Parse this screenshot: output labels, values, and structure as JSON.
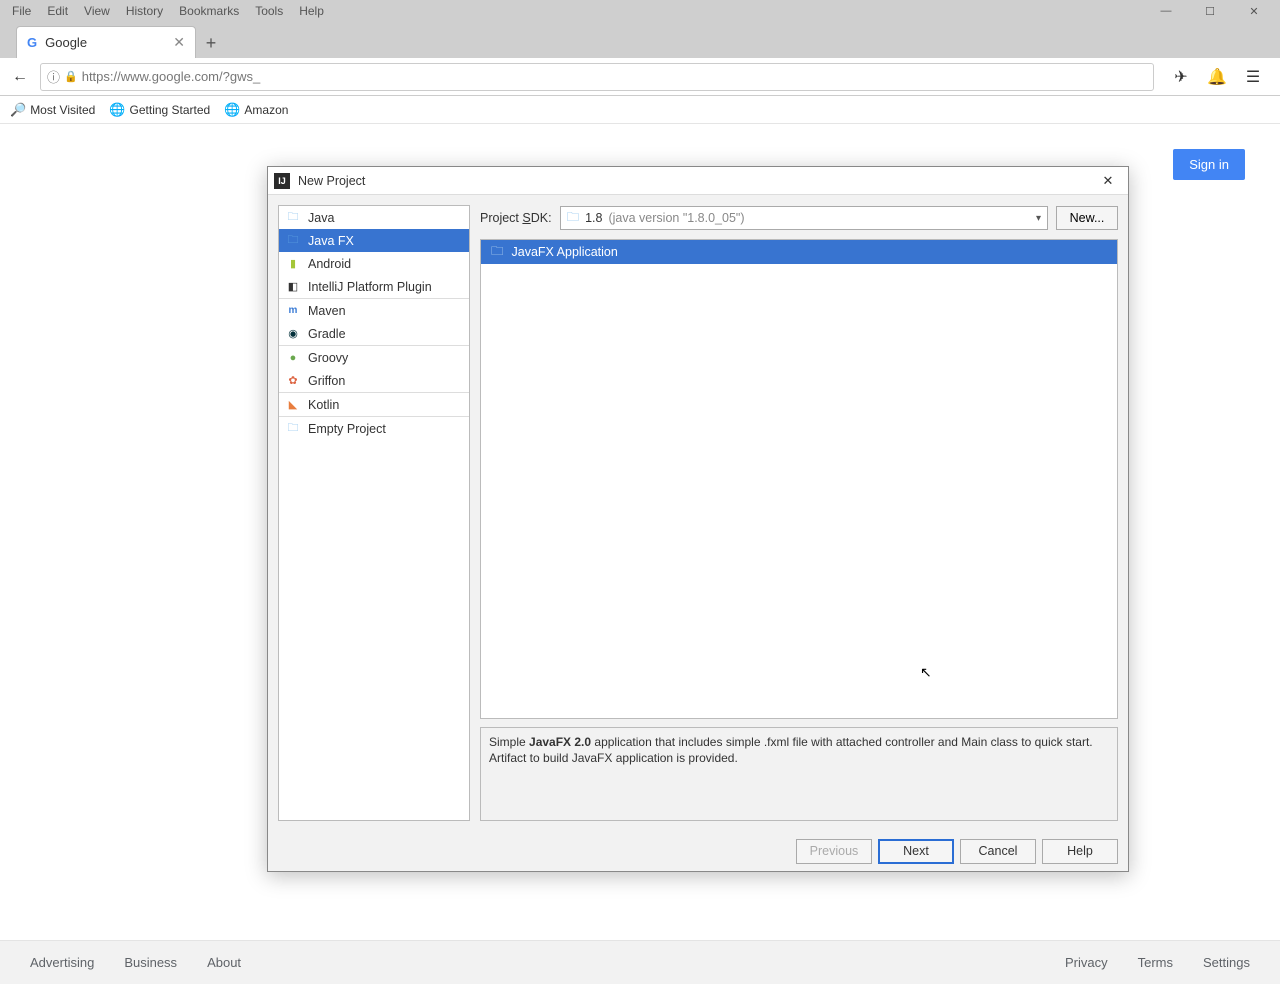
{
  "browser": {
    "menus": [
      "File",
      "Edit",
      "View",
      "History",
      "Bookmarks",
      "Tools",
      "Help"
    ],
    "tab_title": "Google",
    "url": "https://www.google.com/?gws_",
    "bookmarks": [
      "Most Visited",
      "Getting Started",
      "Amazon"
    ],
    "signin": "Sign in",
    "footer_left": [
      "Advertising",
      "Business",
      "About"
    ],
    "footer_right": [
      "Privacy",
      "Terms",
      "Settings"
    ]
  },
  "dialog": {
    "title": "New Project",
    "categories": [
      [
        "Java",
        "Java FX",
        "Android",
        "IntelliJ Platform Plugin"
      ],
      [
        "Maven",
        "Gradle"
      ],
      [
        "Groovy",
        "Griffon"
      ],
      [
        "Kotlin"
      ],
      [
        "Empty Project"
      ]
    ],
    "selected_category": "Java FX",
    "sdk_label_pre": "Project ",
    "sdk_label_u": "S",
    "sdk_label_post": "DK:",
    "sdk_value": "1.8",
    "sdk_detail": "(java version \"1.8.0_05\")",
    "new_button": "New...",
    "template": "JavaFX Application",
    "description_pre": "Simple ",
    "description_bold": "JavaFX 2.0",
    "description_post": " application that includes simple .fxml file with attached controller and Main class to quick start. Artifact to build JavaFX application is provided.",
    "buttons": {
      "previous": "Previous",
      "next": "Next",
      "cancel": "Cancel",
      "help": "Help"
    }
  }
}
